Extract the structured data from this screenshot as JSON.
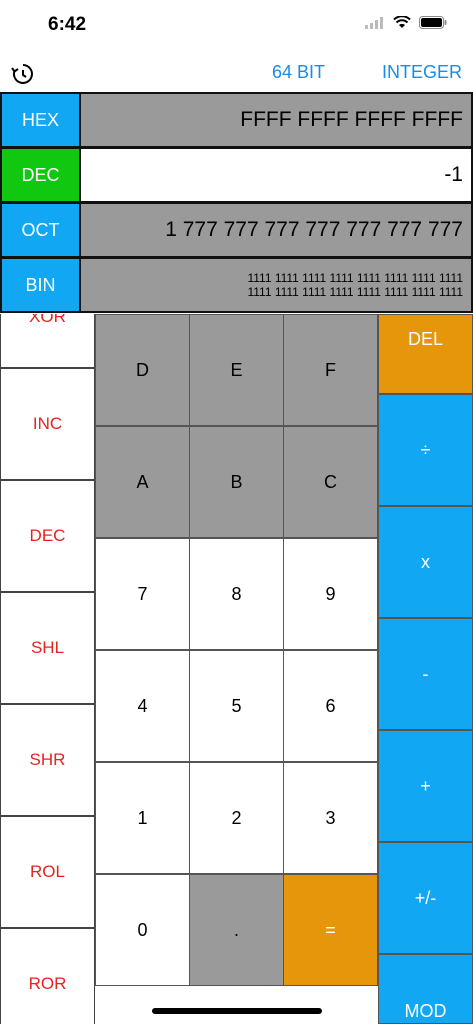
{
  "status": {
    "time": "6:42"
  },
  "topbar": {
    "bit_mode": "64 BIT",
    "number_type": "INTEGER"
  },
  "bases": {
    "hex": {
      "label": "HEX",
      "value": "FFFF FFFF FFFF FFFF"
    },
    "dec": {
      "label": "DEC",
      "value": "-1"
    },
    "oct": {
      "label": "OCT",
      "value": "1 777 777 777 777 777 777 777"
    },
    "bin": {
      "label": "BIN",
      "line1": "1111 1111 1111 1111 1111 1111 1111 1111",
      "line2": "1111 1111 1111 1111 1111 1111 1111 1111"
    }
  },
  "ops": [
    "XOR",
    "INC",
    "DEC",
    "SHL",
    "SHR",
    "ROL",
    "ROR"
  ],
  "keys": {
    "d": "D",
    "e": "E",
    "f": "F",
    "a": "A",
    "b": "B",
    "c": "C",
    "n7": "7",
    "n8": "8",
    "n9": "9",
    "n4": "4",
    "n5": "5",
    "n6": "6",
    "n1": "1",
    "n2": "2",
    "n3": "3",
    "n0": "0",
    "dot": ".",
    "equals": "="
  },
  "right_ops": {
    "del": "DEL",
    "divide": "÷",
    "multiply": "x",
    "minus": "-",
    "plus": "+",
    "negate": "+/-",
    "mod": "MOD"
  },
  "colors": {
    "accent_blue": "#12a7f2",
    "dec_active": "#10c810",
    "op_red": "#e5231f",
    "orange": "#e5960a"
  }
}
